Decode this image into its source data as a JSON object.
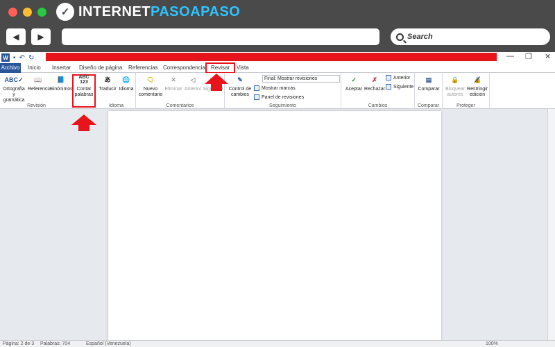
{
  "browser": {
    "logo_text_a": "INTERNET",
    "logo_text_b": "PASOAPASO",
    "back_icon": "back-arrow-icon",
    "forward_icon": "forward-arrow-icon",
    "search_label": "Search"
  },
  "word": {
    "logo": "W",
    "tabs": {
      "file": "Archivo",
      "home": "Inicio",
      "insert": "Insertar",
      "design": "Diseño de página",
      "references": "Referencias",
      "mailings": "Correspondencia",
      "review": "Revisar",
      "view": "Vista"
    },
    "ribbon": {
      "spelling": "Ortografía y gramática",
      "research": "Referencia",
      "thesaurus": "Sinónimos",
      "word_count_icon": "ABC 123",
      "word_count": "Contar palabras",
      "group_proofing": "Revisión",
      "translate": "Traducir",
      "language": "Idioma",
      "group_language": "Idioma",
      "new_comment": "Nuevo comentario",
      "delete": "Eliminar",
      "previous": "Anterior",
      "next": "Siguiente",
      "group_comments": "Comentarios",
      "track_changes": "Control de cambios",
      "display_mode": "Final: Mostrar revisiones",
      "show_markup": "Mostrar marcas",
      "reviewing_pane": "Panel de revisiones",
      "group_tracking": "Seguimiento",
      "accept": "Aceptar",
      "reject": "Rechazar",
      "previous_change": "Anterior",
      "next_change": "Siguiente",
      "group_changes": "Cambios",
      "compare": "Comparar",
      "group_compare": "Comparar",
      "block_authors": "Bloquear autores",
      "restrict_editing": "Restringir edición",
      "group_protect": "Proteger"
    },
    "status": {
      "page": "Página: 2 de 3",
      "words": "Palabras: 704",
      "language": "Español (Venezuela)",
      "zoom": "100%"
    }
  },
  "colors": {
    "highlight": "#e8141c",
    "file_tab": "#2b579a",
    "browser_frame": "#4a4a4a"
  }
}
